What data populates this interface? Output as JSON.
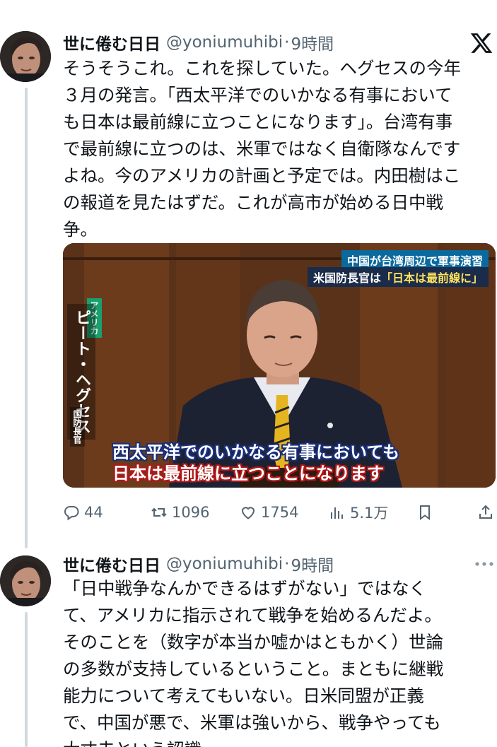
{
  "logo": {
    "icon": "x-logo"
  },
  "tweets": [
    {
      "author": "世に倦む日日",
      "handle": "@yoniumuhibi",
      "separator": "·",
      "time": "9時間",
      "avatar_icon": "avatar",
      "lines": [
        "そうそうこれ。これを探していた。ヘグセスの今年",
        "３月の発言。「西太平洋でのいかなる有事において",
        "も日本は最前線に立つことになります」。台湾有事",
        "で最前線に立つのは、米軍ではなく自衛隊なんです",
        "よね。今のアメリカの計画と予定では。内田樹はこ",
        "の報道を見たはずだ。これが高市が始める日中戦",
        "争。"
      ],
      "media": {
        "ticker_1": "中国が台湾周辺で軍事演習",
        "ticker_2_prefix": "米国防長官は",
        "ticker_2_highlight": "「日本は最前線に」",
        "country_label": "アメリカ",
        "person_label": "ピート・ヘグセス",
        "role_label": "国防長官",
        "subtitle_1": "西太平洋でのいかなる有事においても",
        "subtitle_2": "日本は最前線に立つことになります"
      },
      "actions": {
        "replies": "44",
        "reposts": "1096",
        "likes": "1754",
        "views": "5.1万"
      }
    },
    {
      "author": "世に倦む日日",
      "handle": "@yoniumuhibi",
      "separator": "·",
      "time": "9時間",
      "more_icon": "more-icon",
      "lines": [
        "「日中戦争なんかできるはずがない」ではなく",
        "て、アメリカに指示されて戦争を始めるんだよ。",
        "そのことを（数字が本当か嘘かはともかく）世論",
        "の多数が支持しているということ。まともに継戦",
        "能力について考えてもいない。日米同盟が正義",
        "で、中国が悪で、米軍は強いから、戦争やっても",
        "大丈夫という認識。"
      ]
    }
  ],
  "colors": {
    "text": "#0f1419",
    "secondary": "#536471",
    "thread_line": "#cfd9de"
  }
}
